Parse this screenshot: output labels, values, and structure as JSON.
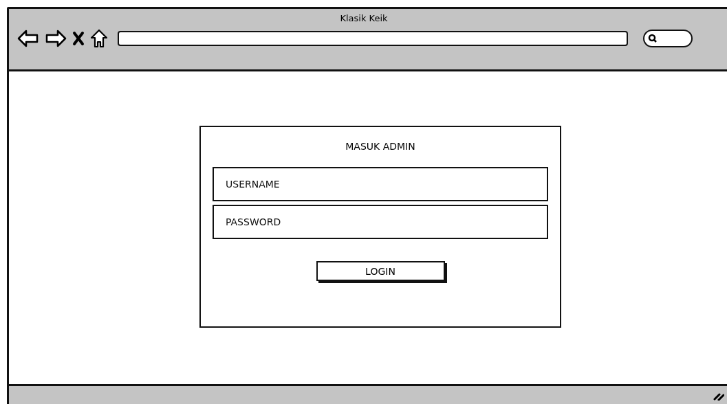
{
  "window": {
    "title": "Klasik Keik"
  },
  "login": {
    "title": "MASUK ADMIN",
    "fields": [
      {
        "placeholder": "USERNAME"
      },
      {
        "placeholder": "PASSWORD"
      }
    ],
    "button": "LOGIN"
  }
}
